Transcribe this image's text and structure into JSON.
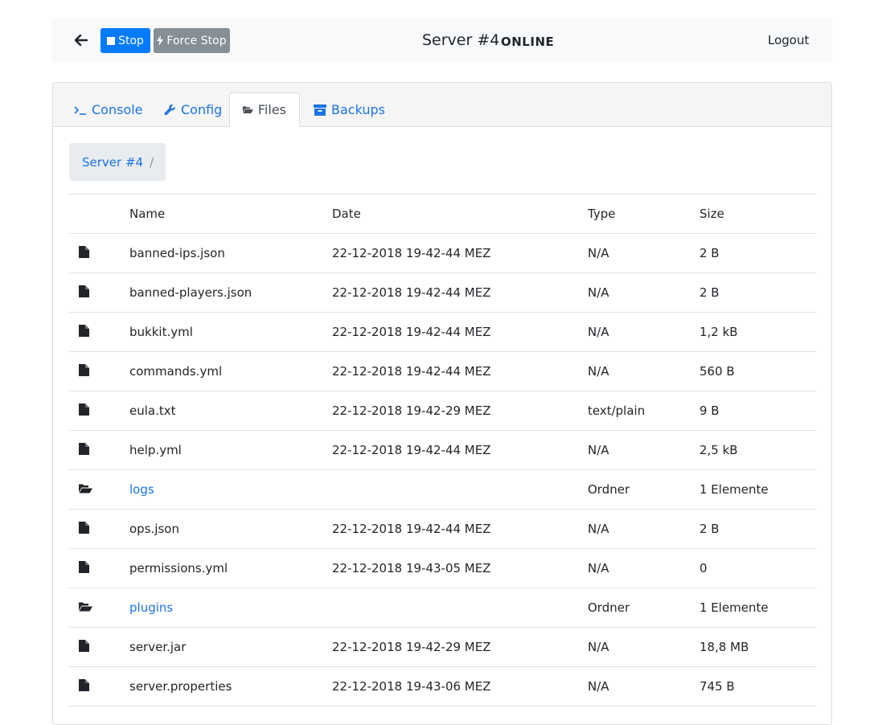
{
  "header": {
    "stop_label": "Stop",
    "force_stop_label": "Force Stop",
    "server_title": "Server #4",
    "status": "ONLINE",
    "logout_label": "Logout"
  },
  "tabs": [
    {
      "label": "Console",
      "icon": "terminal-icon",
      "active": false
    },
    {
      "label": "Config",
      "icon": "wrench-icon",
      "active": false
    },
    {
      "label": "Files",
      "icon": "folder-open-icon",
      "active": true
    },
    {
      "label": "Backups",
      "icon": "archive-icon",
      "active": false
    }
  ],
  "breadcrumb": {
    "root": "Server #4",
    "separator": "/"
  },
  "table": {
    "columns": [
      "Name",
      "Date",
      "Type",
      "Size"
    ],
    "rows": [
      {
        "kind": "file",
        "name": "banned-ips.json",
        "date": "22-12-2018 19-42-44 MEZ",
        "type": "N/A",
        "size": "2 B"
      },
      {
        "kind": "file",
        "name": "banned-players.json",
        "date": "22-12-2018 19-42-44 MEZ",
        "type": "N/A",
        "size": "2 B"
      },
      {
        "kind": "file",
        "name": "bukkit.yml",
        "date": "22-12-2018 19-42-44 MEZ",
        "type": "N/A",
        "size": "1,2 kB"
      },
      {
        "kind": "file",
        "name": "commands.yml",
        "date": "22-12-2018 19-42-44 MEZ",
        "type": "N/A",
        "size": "560 B"
      },
      {
        "kind": "file",
        "name": "eula.txt",
        "date": "22-12-2018 19-42-29 MEZ",
        "type": "text/plain",
        "size": "9 B"
      },
      {
        "kind": "file",
        "name": "help.yml",
        "date": "22-12-2018 19-42-44 MEZ",
        "type": "N/A",
        "size": "2,5 kB"
      },
      {
        "kind": "folder",
        "name": "logs",
        "date": "",
        "type": "Ordner",
        "size": "1 Elemente"
      },
      {
        "kind": "file",
        "name": "ops.json",
        "date": "22-12-2018 19-42-44 MEZ",
        "type": "N/A",
        "size": "2 B"
      },
      {
        "kind": "file",
        "name": "permissions.yml",
        "date": "22-12-2018 19-43-05 MEZ",
        "type": "N/A",
        "size": "0"
      },
      {
        "kind": "folder",
        "name": "plugins",
        "date": "",
        "type": "Ordner",
        "size": "1 Elemente"
      },
      {
        "kind": "file",
        "name": "server.jar",
        "date": "22-12-2018 19-42-29 MEZ",
        "type": "N/A",
        "size": "18,8 MB"
      },
      {
        "kind": "file",
        "name": "server.properties",
        "date": "22-12-2018 19-43-06 MEZ",
        "type": "N/A",
        "size": "745 B"
      }
    ]
  },
  "colors": {
    "primary": "#007bff",
    "secondary": "#868e96",
    "link": "#1a73e8"
  }
}
